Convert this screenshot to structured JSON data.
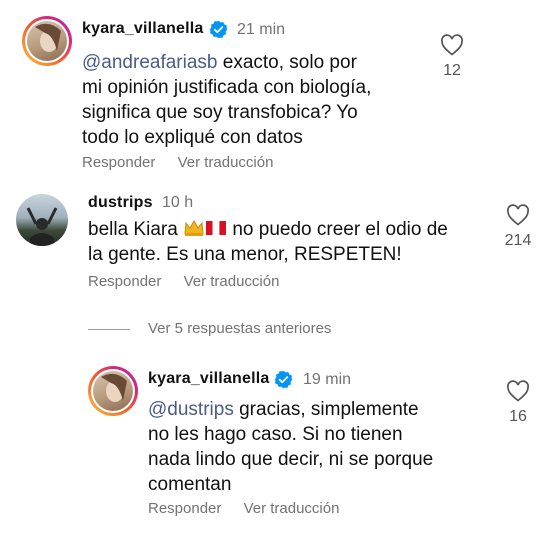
{
  "comments": [
    {
      "username": "kyara_villanella",
      "time": "21 min",
      "mention": "@andreafariasb",
      "text_lines": [
        " exacto, solo por",
        "mi opinión justificada con biología,",
        "significa que soy transfobica? Yo",
        "todo lo expliqué con datos"
      ],
      "reply_label": "Responder",
      "translate_label": "Ver traducción",
      "likes": "12",
      "verified": true
    },
    {
      "username": "dustrips",
      "time": "10 h",
      "text_line1_prefix": "bella Kiara ",
      "text_line1_suffix": " no puedo creer el odio de",
      "text_line2": "la gente. Es una menor, RESPETEN!",
      "reply_label": "Responder",
      "translate_label": "Ver traducción",
      "likes": "214",
      "verified": false
    },
    {
      "username": "kyara_villanella",
      "time": "19 min",
      "mention": "@dustrips",
      "text_lines": [
        " gracias, simplemente",
        "no les hago caso. Si no tienen",
        "nada lindo que decir, ni se porque",
        "comentan"
      ],
      "reply_label": "Responder",
      "translate_label": "Ver traducción",
      "likes": "16",
      "verified": true
    }
  ],
  "view_more_replies": "Ver 5 respuestas anteriores",
  "colors": {
    "verified": "#0095f6",
    "secondary_text": "#737373",
    "mention": "#4a5c8a"
  },
  "icons": [
    "heart-outline-icon",
    "verified-badge-icon",
    "crown-emoji",
    "peru-flag-emoji"
  ]
}
